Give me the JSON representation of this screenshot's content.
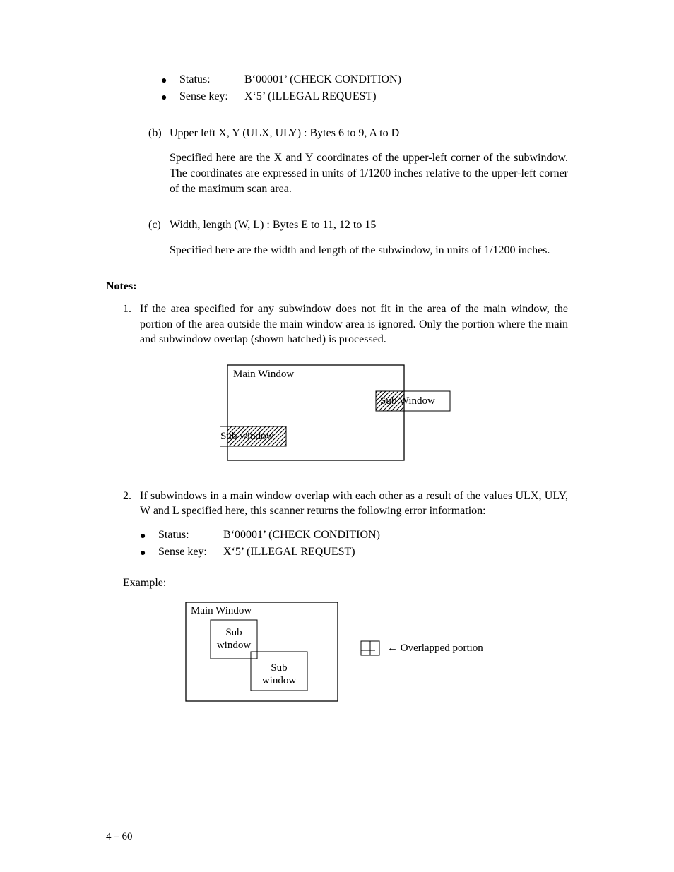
{
  "bullets_a": {
    "status_label": "Status:",
    "status_value": "B‘00001’ (CHECK CONDITION)",
    "sense_label": "Sense key:",
    "sense_value": "X‘5’ (ILLEGAL REQUEST)"
  },
  "item_b": {
    "mark": "(b)",
    "title": "Upper left X, Y (ULX, ULY) : Bytes 6 to 9,  A to D",
    "para": "Specified here are the X and Y coordinates of the upper-left corner of the subwindow.  The coordinates are expressed in units of 1/1200 inches relative to the upper-left corner of the maximum scan area."
  },
  "item_c": {
    "mark": "(c)",
    "title": "Width, length (W, L) :  Bytes E to 11, 12 to 15",
    "para": "Specified here are the width and length of the subwindow, in units of 1/1200 inches."
  },
  "notes_head": "Notes:",
  "note1": {
    "mark": "1.",
    "para": "If the area specified for any subwindow does not fit in the area of the main window, the portion of the area outside the main window area is ignored. Only the portion where the main and subwindow overlap (shown hatched) is processed."
  },
  "diagram1": {
    "main": "Main Window",
    "sub_right": "Sub Window",
    "sub_left": "Sub window"
  },
  "note2": {
    "mark": "2.",
    "para": "If subwindows in a main window overlap with each other as a result of the values ULX, ULY, W and L specified here, this scanner returns the following error information:"
  },
  "bullets_b": {
    "status_label": "Status:",
    "status_value": "B‘00001’ (CHECK CONDITION)",
    "sense_label": "Sense key:",
    "sense_value": "X‘5’ (ILLEGAL REQUEST)"
  },
  "example_head": "Example:",
  "diagram2": {
    "main": "Main Window",
    "sub1": "Sub\nwindow",
    "sub2": "Sub\nwindow",
    "arrow": "← Overlapped portion"
  },
  "page_num": "4 – 60"
}
